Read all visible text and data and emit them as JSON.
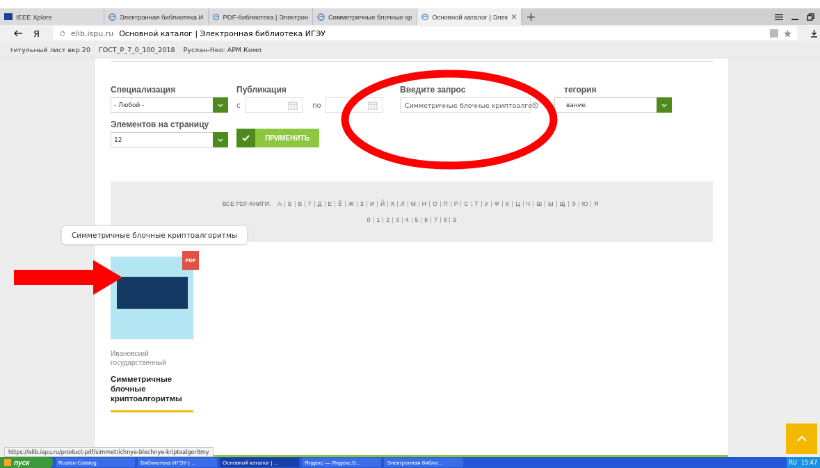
{
  "browser": {
    "tabs": [
      {
        "title": "IEEE Xplore",
        "kind": "ieee",
        "selected": false
      },
      {
        "title": "Электронная библиотека И",
        "kind": "site",
        "selected": false
      },
      {
        "title": "PDF-библиотека | Электрон",
        "kind": "site",
        "selected": false
      },
      {
        "title": "Симметричные блочные кр",
        "kind": "site",
        "selected": false
      },
      {
        "title": "Основной каталог | Элек",
        "kind": "site",
        "selected": true
      }
    ],
    "logo": "Я",
    "url_host": "elib.ispu.ru",
    "url_title": "Основной каталог | Электронная библиотека ИГЭУ",
    "bookmarks": [
      "титульный лист вкр 20",
      "ГОСТ_Р_7_0_100_2018",
      "Руслан-Нео: АРМ Комп"
    ]
  },
  "filters": {
    "specialization": {
      "label": "Специализация",
      "value": "- Любой -"
    },
    "publication": {
      "label": "Публикация",
      "from_label": "с",
      "to_label": "по"
    },
    "query": {
      "label": "Введите запрос",
      "value": "Симметричные блочные криптоалго"
    },
    "category": {
      "label": "тегория",
      "value": "вание"
    },
    "per_page": {
      "label": "Элементов на страницу",
      "value": "12"
    },
    "apply_button": "ПРИМЕНИТЬ"
  },
  "alphabet": {
    "all_label": "ВСЕ PDF-КНИГИ:",
    "letters": [
      "А",
      "Б",
      "В",
      "Г",
      "Д",
      "Е",
      "Ё",
      "Ж",
      "З",
      "И",
      "Й",
      "К",
      "Л",
      "М",
      "Н",
      "О",
      "П",
      "Р",
      "С",
      "Т",
      "У",
      "Ф",
      "Х",
      "Ц",
      "Ч",
      "Ш",
      "Ы",
      "Щ",
      "Э",
      "Ю",
      "Я"
    ],
    "digits": [
      "0",
      "1",
      "2",
      "3",
      "4",
      "5",
      "6",
      "7",
      "8",
      "9"
    ]
  },
  "tooltip": "Симметричные блочные криптоалгоритмы",
  "book": {
    "badge": "PDF",
    "publisher": "Ивановский государственный",
    "title": "Симметричные блочные криптоалгоритмы"
  },
  "status_url": "https://elib.ispu.ru/product-pdf/simmetrichnye-blochnye-kriptoalgoritmy",
  "taskbar": {
    "start": "пуск",
    "items": [
      {
        "label": "Ruslan Catalog",
        "selected": false
      },
      {
        "label": "Библиотека ИГЭУ | ...",
        "selected": false
      },
      {
        "label": "Основной каталог | ...",
        "selected": true
      },
      {
        "label": "Яндекс — Яндекс.Б...",
        "selected": false
      },
      {
        "label": "Электронная библи...",
        "selected": false
      }
    ],
    "lang": "RU",
    "time": "15:47"
  }
}
